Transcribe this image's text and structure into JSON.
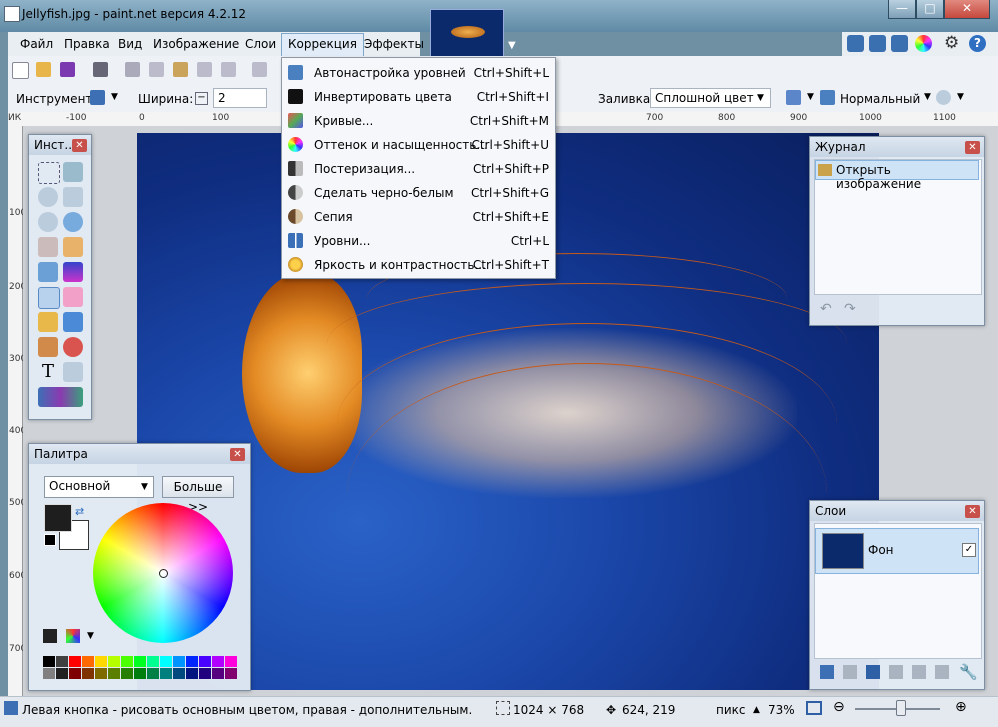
{
  "window": {
    "title": "Jellyfish.jpg - paint.net версия 4.2.12",
    "controls": [
      "—",
      "□",
      "✕"
    ]
  },
  "menubar": [
    "Файл",
    "Правка",
    "Вид",
    "Изображение",
    "Слои",
    "Коррекция",
    "Эффекты"
  ],
  "toolbar2": {
    "tool_label": "Инструмент:",
    "width_label": "Ширина:",
    "width_value": "2",
    "fill_label": "Заливка:",
    "fill_value": "Сплошной цвет",
    "blend_value": "Нормальный"
  },
  "ruler": {
    "h_unit": "ИК",
    "h_ticks": [
      "-100",
      "0",
      "100",
      "700",
      "800",
      "900",
      "1000",
      "1100"
    ],
    "v_ticks": [
      "100",
      "200",
      "300",
      "400",
      "500",
      "600",
      "700"
    ]
  },
  "adjustments_menu": [
    {
      "label": "Автонастройка уровней",
      "shortcut": "Ctrl+Shift+L",
      "icon": "auto-level-icon"
    },
    {
      "label": "Инвертировать цвета",
      "shortcut": "Ctrl+Shift+I",
      "icon": "invert-icon"
    },
    {
      "label": "Кривые...",
      "shortcut": "Ctrl+Shift+M",
      "icon": "curves-icon"
    },
    {
      "label": "Оттенок и насыщенность...",
      "shortcut": "Ctrl+Shift+U",
      "icon": "hue-saturation-icon"
    },
    {
      "label": "Постеризация...",
      "shortcut": "Ctrl+Shift+P",
      "icon": "posterize-icon"
    },
    {
      "label": "Сделать черно-белым",
      "shortcut": "Ctrl+Shift+G",
      "icon": "black-white-icon"
    },
    {
      "label": "Сепия",
      "shortcut": "Ctrl+Shift+E",
      "icon": "sepia-icon"
    },
    {
      "label": "Уровни...",
      "shortcut": "Ctrl+L",
      "icon": "levels-icon"
    },
    {
      "label": "Яркость и контрастность...",
      "shortcut": "Ctrl+Shift+T",
      "icon": "brightness-contrast-icon"
    }
  ],
  "tools_panel": {
    "title": "Инст..."
  },
  "palette_panel": {
    "title": "Палитра",
    "mode_value": "Основной",
    "more_button": "Больше >>"
  },
  "history_panel": {
    "title": "Журнал",
    "items": [
      "Открыть изображение"
    ]
  },
  "layers_panel": {
    "title": "Слои",
    "layers": [
      {
        "name": "Фон",
        "visible": true
      }
    ]
  },
  "statusbar": {
    "hint": "Левая кнопка - рисовать основным цветом, правая - дополнительным.",
    "image_size": "1024 × 768",
    "cursor_pos": "624, 219",
    "unit": "пикс",
    "zoom": "73%"
  },
  "colors": {
    "primary": "#1e1e1e",
    "secondary": "#ffffff",
    "palette_row1": [
      "#000000",
      "#404040",
      "#ff0000",
      "#ff6a00",
      "#ffd800",
      "#b6ff00",
      "#4cff00",
      "#00ff21",
      "#00ff90",
      "#00ffff",
      "#0094ff",
      "#0026ff",
      "#4800ff",
      "#b200ff",
      "#ff00dc"
    ],
    "palette_row2": [
      "#808080",
      "#202020",
      "#7f0000",
      "#7f3300",
      "#7f6a00",
      "#5b7f00",
      "#267f00",
      "#007f0e",
      "#007f46",
      "#007f7f",
      "#004a7f",
      "#00137f",
      "#21007f",
      "#57007f",
      "#7f006e"
    ]
  }
}
